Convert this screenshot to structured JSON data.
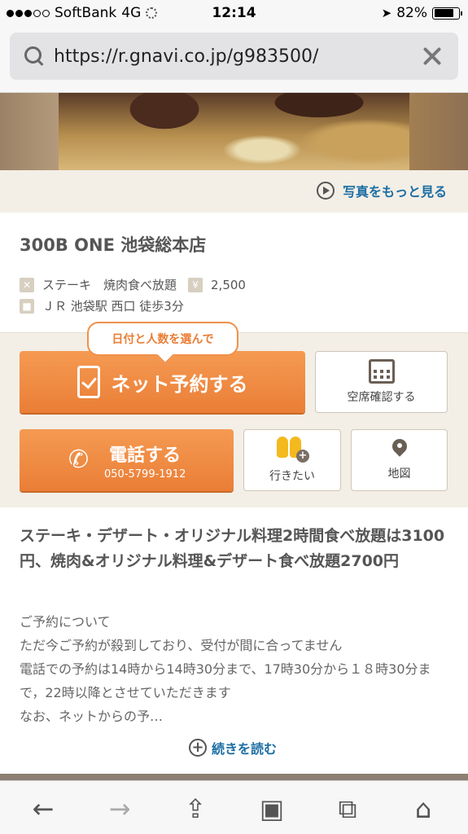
{
  "status_bar": {
    "carrier": "SoftBank",
    "network": "4G",
    "time": "12:14",
    "battery": "82%",
    "battery_level": 0.82
  },
  "browser": {
    "url": "https://r.gnavi.co.jp/g983500/"
  },
  "gallery": {
    "more_photos": "写真をもっと見る"
  },
  "restaurant": {
    "name": "300B ONE 池袋総本店",
    "genre": "ステーキ　焼肉食べ放題",
    "budget_icon": "¥",
    "budget": "2,500",
    "access": "ＪＲ 池袋駅 西口 徒歩3分"
  },
  "actions": {
    "bubble": "日付と人数を選んで",
    "reserve": "ネット予約する",
    "vacancy": "空席確認する",
    "call": "電話する",
    "phone": "050-5799-1912",
    "want_to_go": "行きたい",
    "map": "地図"
  },
  "description": {
    "headline": "ステーキ・デザート・オリジナル料理2時間食べ放題は3100円、焼肉&オリジナル料理&デザート食べ放題2700円",
    "line1": "ご予約について",
    "line2": "ただ今ご予約が殺到しており、受付が間に合ってません",
    "line3": "電話での予約は14時から14時30分まで、17時30分から１８時30分まで，22時以降とさせていただきます",
    "line4": "なお、ネットからの予…",
    "read_more": "続きを読む"
  },
  "colors": {
    "accent_orange": "#ea7e36",
    "link_blue": "#1c6ea4",
    "beige": "#f3efe6"
  },
  "toolbar": {
    "back": "back-icon",
    "forward": "forward-icon",
    "share": "share-icon",
    "bookmarks": "bookmarks-icon",
    "tabs": "tabs-icon",
    "home": "home-icon"
  }
}
